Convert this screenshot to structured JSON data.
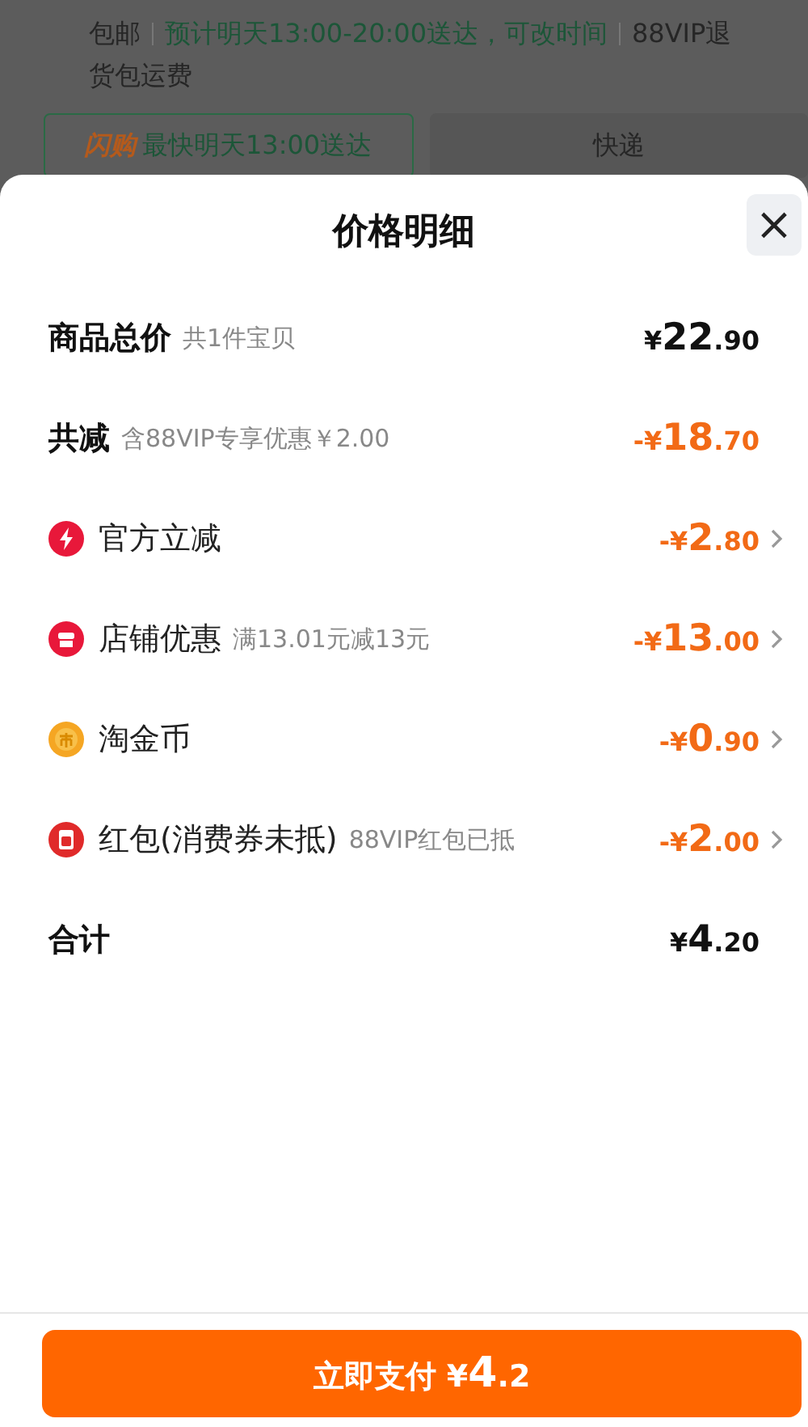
{
  "background": {
    "shipping_parts": [
      {
        "text": "包邮",
        "kind": "plain"
      },
      {
        "text": "预计明天13:00-20:00送达，可改时间",
        "kind": "highlight"
      },
      {
        "text": "88VIP退货包运费",
        "kind": "plain"
      }
    ],
    "delivery_options": [
      {
        "brand": "闪购",
        "label": "最快明天13:00送达",
        "selected": true
      },
      {
        "label": "快递",
        "selected": false
      }
    ]
  },
  "sheet": {
    "title": "价格明细",
    "close": "×",
    "rows": [
      {
        "kind": "summary",
        "label": "商品总价",
        "note": "共1件宝贝",
        "amount": {
          "sign": "¥",
          "whole": "22",
          "fraction": ".90"
        },
        "negative": false
      },
      {
        "kind": "summary",
        "label": "共减",
        "note": "含88VIP专享优惠￥2.00",
        "amount": {
          "sign": "-¥",
          "whole": "18",
          "fraction": ".70"
        },
        "negative": true
      },
      {
        "kind": "instant",
        "color": "#e8183a",
        "label": "官方立减",
        "amount": {
          "sign": "-¥",
          "whole": "2",
          "fraction": ".80"
        },
        "negative": true
      },
      {
        "kind": "shop",
        "color": "#e8183a",
        "label": "店铺优惠",
        "note": "满13.01元减13元",
        "amount": {
          "sign": "-¥",
          "whole": "13",
          "fraction": ".00"
        },
        "negative": true
      },
      {
        "kind": "coin",
        "color": "#f5a623",
        "label": "淘金币",
        "amount": {
          "sign": "-¥",
          "whole": "0",
          "fraction": ".90"
        },
        "negative": true
      },
      {
        "kind": "voucher",
        "color": "#e02a2a",
        "label": "红包(消费券未抵)",
        "note": "88VIP红包已抵",
        "amount": {
          "sign": "-¥",
          "whole": "2",
          "fraction": ".00"
        },
        "negative": true
      },
      {
        "kind": "summary",
        "label": "合计",
        "amount": {
          "sign": "¥",
          "whole": "4",
          "fraction": ".20"
        },
        "negative": false
      }
    ],
    "pay_button": {
      "label": "立即支付",
      "sign": "¥",
      "whole": "4",
      "fraction": ".2"
    }
  }
}
